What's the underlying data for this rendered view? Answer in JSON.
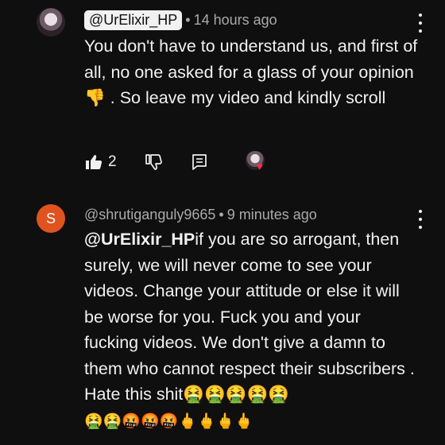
{
  "comments": [
    {
      "handle": "@UrElixir_HP",
      "time": "14 hours ago",
      "text": "You don't have to understand us, and first of all,  no one asked for a glass of your opinion 👎 . So leave my video and kindly scroll",
      "likes": "2"
    },
    {
      "avatar_letter": "S",
      "handle": "@shrutiganguly9665",
      "time": "9 minutes ago",
      "mention": "@UrElixir_HP",
      "text": "if you are so arrogant, then surely, we will never come to see your videos. Change your attitude or else it will be worse for you. Fuck you and your fucking videos. We don't give a damn to them who cannot respect their subscribers . Hate this shit🤮🤮🤮🤮🤮",
      "emoji_line": "🤮🤮🤬🤬🤬🖕🖕🖕🖕"
    }
  ],
  "colors": {
    "background": "#0f0f0f",
    "avatar_letter_bg": "#e0531f",
    "heart": "#ff2b43"
  },
  "icons": [
    "thumbs-up-filled-icon",
    "thumbs-down-icon",
    "reply-icon",
    "creator-heart-icon",
    "more-vert-icon"
  ]
}
